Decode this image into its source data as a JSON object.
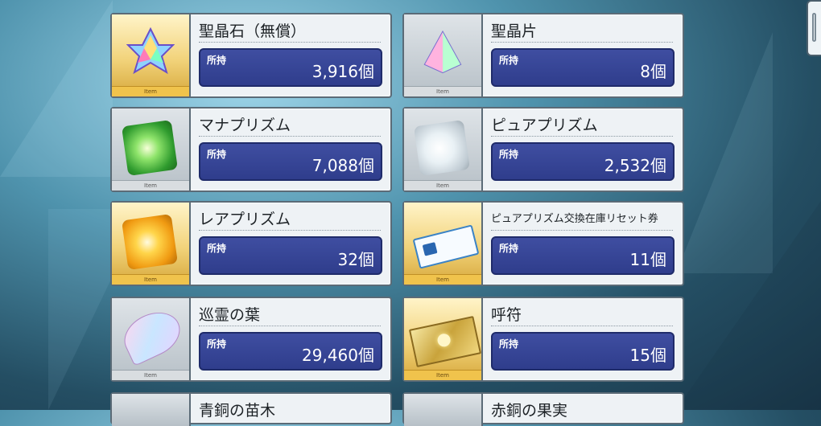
{
  "owned_label": "所持",
  "items": [
    {
      "name": "聖晶石（無償）",
      "count": "3,916個",
      "tag": "Item",
      "icon": "saint-quartz-icon",
      "gold": true
    },
    {
      "name": "聖晶片",
      "count": "8個",
      "tag": "Item",
      "icon": "saint-quartz-fragment-icon",
      "gold": false
    },
    {
      "name": "マナプリズム",
      "count": "7,088個",
      "tag": "Item",
      "icon": "mana-prism-icon",
      "gold": false
    },
    {
      "name": "ピュアプリズム",
      "count": "2,532個",
      "tag": "Item",
      "icon": "pure-prism-icon",
      "gold": false
    },
    {
      "name": "レアプリズム",
      "count": "32個",
      "tag": "Item",
      "icon": "rare-prism-icon",
      "gold": true
    },
    {
      "name": "ピュアプリズム交換在庫リセット券",
      "count": "11個",
      "tag": "Item",
      "icon": "ticket-icon",
      "gold": true
    },
    {
      "name": "巡霊の葉",
      "count": "29,460個",
      "tag": "Item",
      "icon": "leaf-icon",
      "gold": false
    },
    {
      "name": "呼符",
      "count": "15個",
      "tag": "Item",
      "icon": "summon-ticket-icon",
      "gold": true
    }
  ],
  "partial_items": [
    {
      "name": "青銅の苗木"
    },
    {
      "name": "赤銅の果実"
    }
  ]
}
